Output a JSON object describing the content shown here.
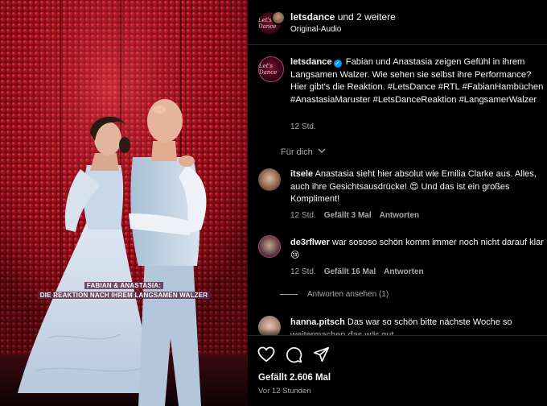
{
  "header": {
    "account": "letsdance",
    "collab": "und 2 weitere",
    "audio": "Original-Audio"
  },
  "post": {
    "username": "letsdance",
    "verified": "✓",
    "text": "Fabian und Anastasia zeigen Gefühl in ihrem Langsamen Walzer. Wie sehen sie selbst ihre Performance? Hier gibt's die Reaktion.",
    "hashtags": "#LetsDance #RTL #FabianHambüchen #AnastasiaMaruster #LetsDanceReaktion #LangsamerWalzer",
    "time": "12 Std."
  },
  "media": {
    "caption_line1": "FABIAN & ANASTASIA:",
    "caption_line2": "DIE REAKTION NACH IHREM LANGSAMEN WALZER"
  },
  "for_you": "Für dich",
  "comments": [
    {
      "username": "itsele",
      "text": "Anastasia sieht hier absolut wie Emilia Clarke aus. Alles, auch ihre Gesichtsausdrücke! 😍 Und das ist ein großes Kompliment!",
      "time": "12 Std.",
      "likes": "Gefällt 3 Mal",
      "reply": "Antworten"
    },
    {
      "username": "de3rflwer",
      "text": "war sososo schön komm immer noch nicht darauf klar😢",
      "time": "12 Std.",
      "likes": "Gefällt 16 Mal",
      "reply": "Antworten"
    },
    {
      "username": "hanna.pitsch",
      "text": "Das war so schön bitte nächste Woche so weitermachen das wär gut"
    }
  ],
  "view_replies": "Antworten ansehen (1)",
  "footer": {
    "likes": "Gefällt 2.606 Mal",
    "time_ago": "Vor 12 Stunden"
  },
  "brand_logo_text": "Let's Dance",
  "icons": [
    "heart-icon",
    "comment-icon",
    "share-icon",
    "verified-icon",
    "chevron-down-icon"
  ],
  "colors": {
    "background": "#000000",
    "text": "#f5f5f5",
    "secondary_text": "#a8a8a8",
    "verified_blue": "#0095f6",
    "media_red": "#b0101e"
  }
}
